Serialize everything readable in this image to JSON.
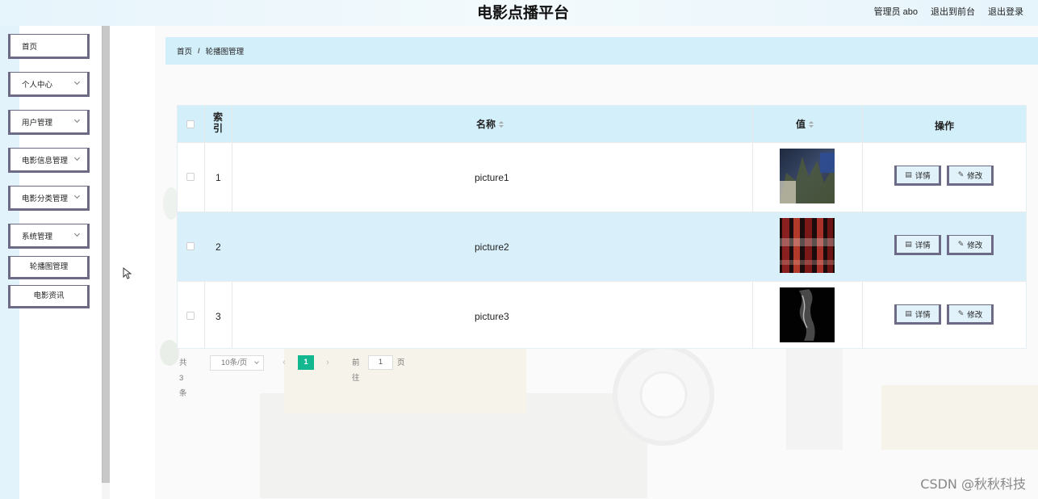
{
  "header": {
    "title": "电影点播平台",
    "admin_label": "管理员 abo",
    "front_link": "退出到前台",
    "logout_link": "退出登录"
  },
  "sidebar": {
    "items": [
      {
        "label": "首页",
        "has_arrow": false
      },
      {
        "label": "个人中心",
        "has_arrow": true
      },
      {
        "label": "用户管理",
        "has_arrow": true
      },
      {
        "label": "电影信息管理",
        "has_arrow": true
      },
      {
        "label": "电影分类管理",
        "has_arrow": true
      },
      {
        "label": "系统管理",
        "has_arrow": true
      }
    ],
    "sub_items": [
      {
        "label": "轮播图管理"
      },
      {
        "label": "电影资讯"
      }
    ]
  },
  "breadcrumb": {
    "home": "首页",
    "separator": "/",
    "current": "轮播图管理"
  },
  "table": {
    "headers": {
      "index": "索引",
      "name": "名称",
      "value": "值",
      "actions": "操作"
    },
    "rows": [
      {
        "index": "1",
        "name": "picture1",
        "thumb": "night-street-image"
      },
      {
        "index": "2",
        "name": "picture2",
        "thumb": "red-neon-image"
      },
      {
        "index": "3",
        "name": "picture3",
        "thumb": "dark-figure-image"
      }
    ],
    "detail_label": "详情",
    "edit_label": "修改"
  },
  "pagination": {
    "total": "共 3 条",
    "page_size": "10条/页",
    "current_page": "1",
    "goto_label": "前往",
    "goto_value": "1",
    "page_suffix": "页"
  },
  "watermark": "CSDN @秋秋科技",
  "colors": {
    "accent_bar": "#d3effa",
    "active_page": "#13b790",
    "button_border": "#6d6a86"
  }
}
